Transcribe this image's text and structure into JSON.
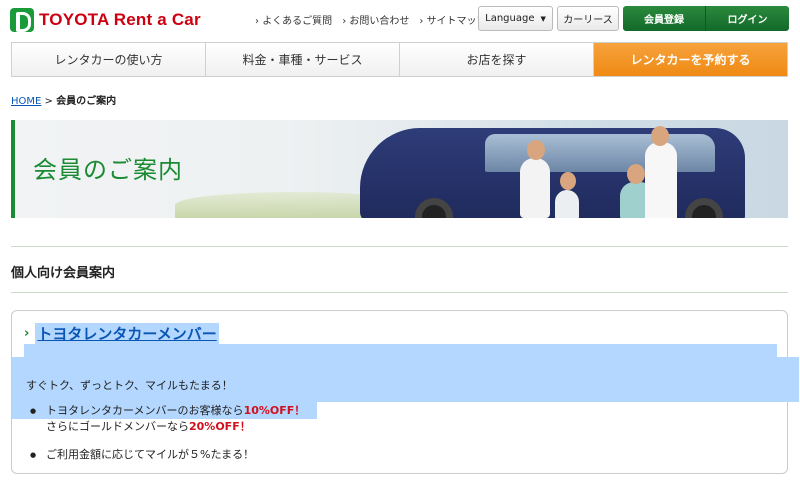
{
  "header": {
    "logo_text": "TOYOTA Rent a Car",
    "links": [
      "よくあるご質問",
      "お問い合わせ",
      "サイトマップ"
    ],
    "language_label": "Language",
    "lease_label": "カーリース",
    "member_label": "会員登録",
    "login_label": "ログイン"
  },
  "nav": {
    "items": [
      "レンタカーの使い方",
      "料金・車種・サービス",
      "お店を探す",
      "レンタカーを予約する"
    ]
  },
  "breadcrumb": {
    "home": "HOME",
    "separator": ">",
    "current": "会員のご案内"
  },
  "banner": {
    "title": "会員のご案内"
  },
  "section": {
    "title": "個人向け会員案内"
  },
  "card": {
    "link": "トヨタレンタカーメンバー",
    "lead": "すぐトク、ずっとトク、マイルもたまる！",
    "bullet1_prefix": "トヨタレンタカーメンバーのお客様なら",
    "bullet1_highlight": "10%OFF！",
    "bullet1b_prefix": "さらにゴールドメンバーなら",
    "bullet1b_highlight": "20%OFF！",
    "bullet2": "ご利用金額に応じてマイルが５%たまる！"
  },
  "colors": {
    "brand_green": "#1a8a33",
    "brand_red": "#cc0010",
    "reserve_orange": "#ef8a14",
    "link_blue": "#0a56b5",
    "selection": "#b3d7ff"
  }
}
